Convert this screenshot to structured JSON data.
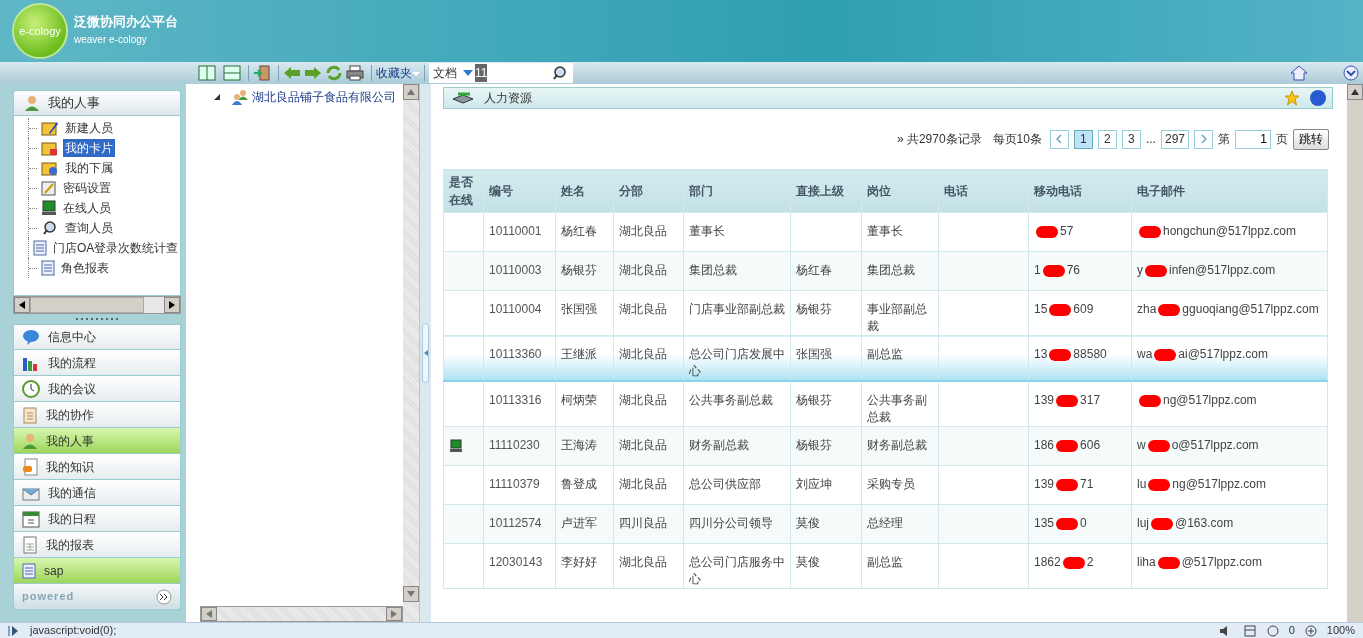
{
  "app": {
    "logo_text": "e-cology",
    "title": "泛微协同办公平台",
    "subtitle": "weaver e-cology"
  },
  "toolbar": {
    "favorites": "收藏夹",
    "search_type": "文档",
    "search_value": "11"
  },
  "sidebar": {
    "section_title": "我的人事",
    "items": [
      {
        "label": "新建人员",
        "selected": false
      },
      {
        "label": "我的卡片",
        "selected": true
      },
      {
        "label": "我的下属",
        "selected": false
      },
      {
        "label": "密码设置",
        "selected": false
      },
      {
        "label": "在线人员",
        "selected": false
      },
      {
        "label": "查询人员",
        "selected": false
      },
      {
        "label": "门店OA登录次数统计查",
        "selected": false
      },
      {
        "label": "角色报表",
        "selected": false
      }
    ],
    "menu": [
      {
        "label": "信息中心",
        "selected": false
      },
      {
        "label": "我的流程",
        "selected": false
      },
      {
        "label": "我的会议",
        "selected": false
      },
      {
        "label": "我的协作",
        "selected": false
      },
      {
        "label": "我的人事",
        "selected": true
      },
      {
        "label": "我的知识",
        "selected": false
      },
      {
        "label": "我的通信",
        "selected": false
      },
      {
        "label": "我的日程",
        "selected": false
      },
      {
        "label": "我的报表",
        "selected": false
      },
      {
        "label": "sap",
        "selected": true
      }
    ],
    "footer": "powered"
  },
  "tree": {
    "root": {
      "label": "湖北良品铺子食品有限公司",
      "expanded": true
    }
  },
  "panel": {
    "title": "人力资源"
  },
  "pagination": {
    "summary": "» 共2970条记录",
    "per_page": "每页10条",
    "pages": [
      {
        "label": "1",
        "selected": true
      },
      {
        "label": "2",
        "selected": false
      },
      {
        "label": "3",
        "selected": false
      }
    ],
    "ellipsis": "...",
    "last": "297",
    "goto_prefix": "第",
    "goto_value": "1",
    "goto_suffix": "页",
    "goto_button": "跳转"
  },
  "table": {
    "columns": [
      "是否在线",
      "编号",
      "姓名",
      "分部",
      "部门",
      "直接上级",
      "岗位",
      "电话",
      "移动电话",
      "电子邮件"
    ],
    "rows": [
      {
        "online": false,
        "highlighted": false,
        "id": "10110001",
        "name": "杨红春",
        "branch": "湖北良品",
        "dept": "董事长",
        "position": "董事长",
        "mobile": {
          "tail": "57"
        },
        "email": {
          "tail": "hongchun@517lppz.com"
        }
      },
      {
        "online": false,
        "highlighted": false,
        "id": "10110003",
        "name": "杨银芬",
        "branch": "湖北良品",
        "dept": "集团总裁",
        "manager": "杨红春",
        "position": "集团总裁",
        "mobile": {
          "head": "1",
          "tail": "76"
        },
        "email": {
          "head": "y",
          "tail": "infen@517lppz.com"
        }
      },
      {
        "online": false,
        "highlighted": false,
        "id": "10110004",
        "name": "张国强",
        "branch": "湖北良品",
        "dept": "门店事业部副总裁",
        "manager": "杨银芬",
        "position": "事业部副总裁",
        "mobile": {
          "head": "15",
          "tail": "609"
        },
        "email": {
          "head": "zha",
          "tail": "gguoqiang@517lppz.com"
        }
      },
      {
        "online": false,
        "highlighted": true,
        "id": "10113360",
        "name": "王继派",
        "branch": "湖北良品",
        "dept": "总公司门店发展中心",
        "manager": "张国强",
        "position": "副总监",
        "mobile": {
          "head": "13",
          "tail": "88580"
        },
        "email": {
          "head": "wa",
          "tail": "ai@517lppz.com"
        }
      },
      {
        "online": false,
        "highlighted": false,
        "id": "10113316",
        "name": "柯炳荣",
        "branch": "湖北良品",
        "dept": "公共事务副总裁",
        "manager": "杨银芬",
        "position": "公共事务副总裁",
        "mobile": {
          "head": "139",
          "tail": "317"
        },
        "email": {
          "tail": "ng@517lppz.com"
        }
      },
      {
        "online": true,
        "highlighted": false,
        "id": "11110230",
        "name": "王海涛",
        "branch": "湖北良品",
        "dept": "财务副总裁",
        "manager": "杨银芬",
        "position": "财务副总裁",
        "mobile": {
          "head": "186",
          "tail": "606"
        },
        "email": {
          "head": "w",
          "tail": "o@517lppz.com"
        }
      },
      {
        "online": false,
        "highlighted": false,
        "id": "11110379",
        "name": "鲁登成",
        "branch": "湖北良品",
        "dept": "总公司供应部",
        "manager": "刘应坤",
        "position": "采购专员",
        "mobile": {
          "head": "139",
          "tail": "71"
        },
        "email": {
          "head": "lu",
          "tail": "ng@517lppz.com"
        }
      },
      {
        "online": false,
        "highlighted": false,
        "id": "10112574",
        "name": "卢进军",
        "branch": "四川良品",
        "dept": "四川分公司领导",
        "manager": "莫俊",
        "position": "总经理",
        "mobile": {
          "head": "135",
          "tail": "0"
        },
        "email": {
          "head": "luj",
          "tail": "@163.com"
        }
      },
      {
        "online": false,
        "highlighted": false,
        "id": "12030143",
        "name": "李好好",
        "branch": "湖北良品",
        "dept": "总公司门店服务中心",
        "manager": "莫俊",
        "position": "副总监",
        "mobile": {
          "head": "1862",
          "tail": "2"
        },
        "email": {
          "head": "liha",
          "tail": "@517lppz.com"
        }
      }
    ]
  },
  "status_bar": {
    "text": "javascript:void(0);",
    "count": "0",
    "zoom": "100%"
  }
}
